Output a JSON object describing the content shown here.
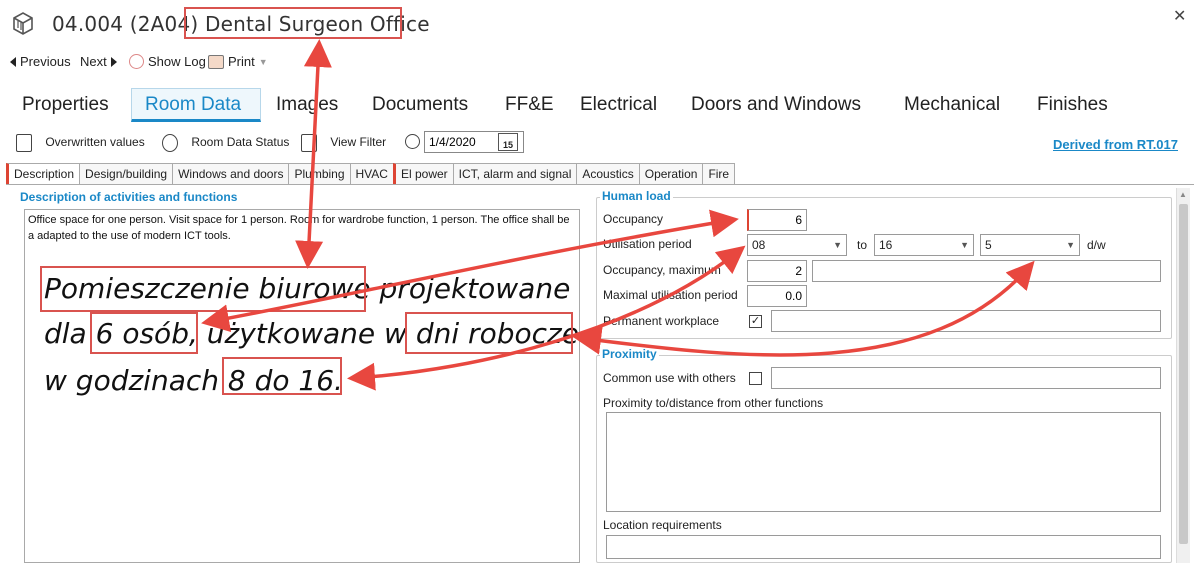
{
  "header": {
    "room_code": "04.004 (2A04)",
    "room_name": "Dental Surgeon Office",
    "icon": "room-cube-icon"
  },
  "nav": {
    "previous": "Previous",
    "next": "Next",
    "show_log": "Show Log",
    "print": "Print"
  },
  "main_tabs": [
    {
      "label": "Properties"
    },
    {
      "label": "Room Data"
    },
    {
      "label": "Images"
    },
    {
      "label": "Documents"
    },
    {
      "label": "FF&E"
    },
    {
      "label": "Electrical"
    },
    {
      "label": "Doors and Windows"
    },
    {
      "label": "Mechanical"
    },
    {
      "label": "Finishes"
    }
  ],
  "toolbar": {
    "overwritten_values": "Overwritten values",
    "room_data_status": "Room Data Status",
    "view_filter": "View Filter",
    "date": "1/4/2020",
    "calendar_day": "15",
    "derived_from": "Derived from RT.017"
  },
  "sub_tabs": [
    {
      "label": "Description"
    },
    {
      "label": "Design/building"
    },
    {
      "label": "Windows and doors"
    },
    {
      "label": "Plumbing"
    },
    {
      "label": "HVAC"
    },
    {
      "label": "El power"
    },
    {
      "label": "ICT, alarm and signal"
    },
    {
      "label": "Acoustics"
    },
    {
      "label": "Operation"
    },
    {
      "label": "Fire"
    }
  ],
  "description": {
    "title": "Description of activities and functions",
    "text": "Office space for one person. Visit space for 1 person. Room for wardrobe function, 1 person. The office shall be a adapted to the use of modern ICT tools."
  },
  "annotation": {
    "line1_a": "Pomieszczenie biurowe",
    "line1_b": "projektowane",
    "line2_a": "dla",
    "line2_b": "6 osób,",
    "line2_c": "użytkowane w",
    "line2_d": "dni robocze",
    "line3_a": "w godzinach",
    "line3_b": "8 do 16."
  },
  "human_load": {
    "title": "Human load",
    "occupancy_label": "Occupancy",
    "occupancy_value": "6",
    "utilisation_label": "Utilisation period",
    "from_value": "08",
    "to_label": "to",
    "to_value": "16",
    "days_value": "5",
    "days_unit": "d/w",
    "occupancy_max_label": "Occupancy, maximum",
    "occupancy_max_value": "2",
    "max_util_label": "Maximal utilisation period",
    "max_util_value": "0.0",
    "permanent_label": "Permanent workplace",
    "permanent_check": "✓"
  },
  "proximity": {
    "title": "Proximity",
    "common_use_label": "Common use with others",
    "proximity_label": "Proximity to/distance from other functions",
    "location_label": "Location requirements"
  },
  "colors": {
    "accent": "#1a88c7",
    "annotation_red": "#d9534f"
  }
}
